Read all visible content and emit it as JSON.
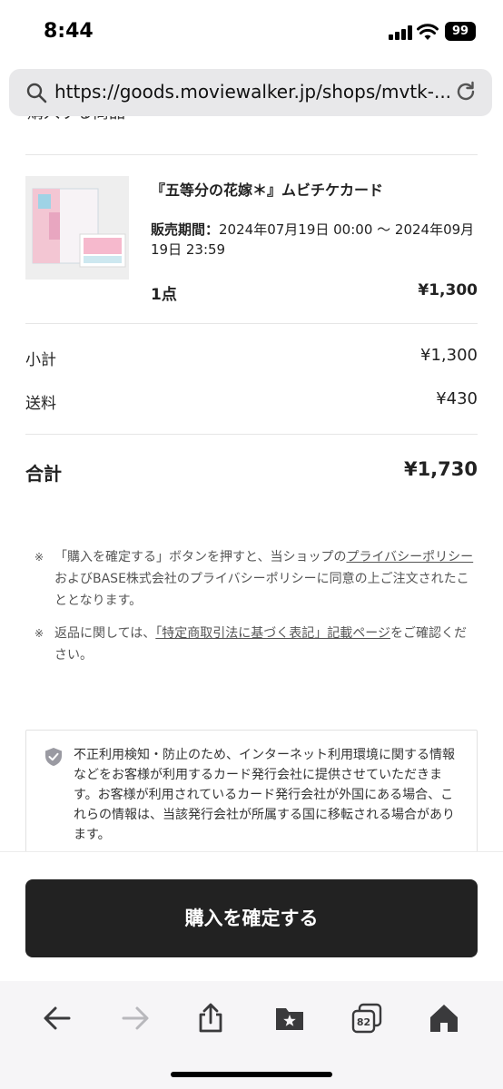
{
  "status_bar": {
    "time": "8:44",
    "battery": "99"
  },
  "browser": {
    "url": "https://goods.moviewalker.jp/shops/mvtk-..."
  },
  "order": {
    "cut_off_text": "購入する商品",
    "item": {
      "name": "『五等分の花嫁＊』ムビチケカード",
      "period_label": "販売期間：",
      "period_value": "2024年07月19日 00:00 〜 2024年09月19日 23:59",
      "quantity": "1点",
      "price": "¥1,300"
    },
    "subtotal_label": "小計",
    "subtotal_value": "¥1,300",
    "shipping_label": "送料",
    "shipping_value": "¥430",
    "total_label": "合計",
    "total_value": "¥1,730"
  },
  "notes": {
    "mark": "※",
    "note1_pre": "「購入を確定する」ボタンを押すと、当ショップの",
    "note1_link": "プライバシーポリシー",
    "note1_post": "およびBASE株式会社のプライバシーポリシーに同意の上ご注文されたこととなります。",
    "note2_pre": "返品に関しては、",
    "note2_link": "「特定商取引法に基づく表記」記載ページ",
    "note2_post": "をご確認ください。"
  },
  "security": {
    "text": "不正利用検知・防止のため、インターネット利用環境に関する情報などをお客様が利用するカード発行会社に提供させていただきます。お客様が利用されているカード発行会社が外国にある場合、これらの情報は、当該発行会社が所属する国に移転される場合があります。"
  },
  "purchase_button_label": "購入を確定する",
  "toolbar": {
    "tabs_count": "82"
  }
}
